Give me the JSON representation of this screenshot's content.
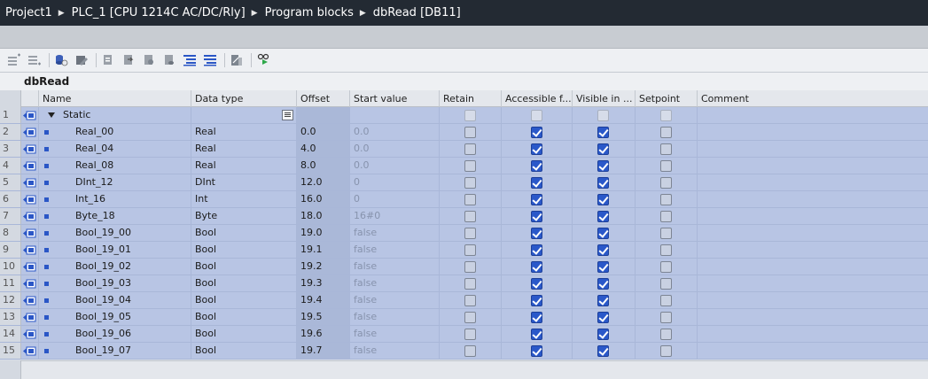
{
  "breadcrumb": [
    "Project1",
    "PLC_1 [CPU 1214C AC/DC/Rly]",
    "Program blocks",
    "dbRead [DB11]"
  ],
  "block_title": "dbRead",
  "toolbar_icons": [
    "insert-row-icon",
    "add-row-icon",
    "reset-start-values-icon",
    "snapshot-icon",
    "copy-snapshot-icon",
    "load-start-values-icon",
    "load-snapshot-icon",
    "monitor-icon",
    "expand-all-icon",
    "collapse-all-icon",
    "keep-actual-values-icon",
    "monitor-all-icon"
  ],
  "columns": {
    "name": "Name",
    "data_type": "Data type",
    "offset": "Offset",
    "start_value": "Start value",
    "retain": "Retain",
    "accessible": "Accessible f...",
    "visible": "Visible in ...",
    "setpoint": "Setpoint",
    "comment": "Comment"
  },
  "rows": [
    {
      "num": "1",
      "name": "Static",
      "type": "",
      "offset": "",
      "start": "",
      "retain": false,
      "accessible": false,
      "visible": false,
      "setpoint": false
    },
    {
      "num": "2",
      "name": "Real_00",
      "type": "Real",
      "offset": "0.0",
      "start": "0.0",
      "retain": false,
      "accessible": true,
      "visible": true,
      "setpoint": false
    },
    {
      "num": "3",
      "name": "Real_04",
      "type": "Real",
      "offset": "4.0",
      "start": "0.0",
      "retain": false,
      "accessible": true,
      "visible": true,
      "setpoint": false
    },
    {
      "num": "4",
      "name": "Real_08",
      "type": "Real",
      "offset": "8.0",
      "start": "0.0",
      "retain": false,
      "accessible": true,
      "visible": true,
      "setpoint": false
    },
    {
      "num": "5",
      "name": "DInt_12",
      "type": "DInt",
      "offset": "12.0",
      "start": "0",
      "retain": false,
      "accessible": true,
      "visible": true,
      "setpoint": false
    },
    {
      "num": "6",
      "name": "Int_16",
      "type": "Int",
      "offset": "16.0",
      "start": "0",
      "retain": false,
      "accessible": true,
      "visible": true,
      "setpoint": false
    },
    {
      "num": "7",
      "name": "Byte_18",
      "type": "Byte",
      "offset": "18.0",
      "start": "16#0",
      "retain": false,
      "accessible": true,
      "visible": true,
      "setpoint": false
    },
    {
      "num": "8",
      "name": "Bool_19_00",
      "type": "Bool",
      "offset": "19.0",
      "start": "false",
      "retain": false,
      "accessible": true,
      "visible": true,
      "setpoint": false
    },
    {
      "num": "9",
      "name": "Bool_19_01",
      "type": "Bool",
      "offset": "19.1",
      "start": "false",
      "retain": false,
      "accessible": true,
      "visible": true,
      "setpoint": false
    },
    {
      "num": "10",
      "name": "Bool_19_02",
      "type": "Bool",
      "offset": "19.2",
      "start": "false",
      "retain": false,
      "accessible": true,
      "visible": true,
      "setpoint": false
    },
    {
      "num": "11",
      "name": "Bool_19_03",
      "type": "Bool",
      "offset": "19.3",
      "start": "false",
      "retain": false,
      "accessible": true,
      "visible": true,
      "setpoint": false
    },
    {
      "num": "12",
      "name": "Bool_19_04",
      "type": "Bool",
      "offset": "19.4",
      "start": "false",
      "retain": false,
      "accessible": true,
      "visible": true,
      "setpoint": false
    },
    {
      "num": "13",
      "name": "Bool_19_05",
      "type": "Bool",
      "offset": "19.5",
      "start": "false",
      "retain": false,
      "accessible": true,
      "visible": true,
      "setpoint": false
    },
    {
      "num": "14",
      "name": "Bool_19_06",
      "type": "Bool",
      "offset": "19.6",
      "start": "false",
      "retain": false,
      "accessible": true,
      "visible": true,
      "setpoint": false
    },
    {
      "num": "15",
      "name": "Bool_19_07",
      "type": "Bool",
      "offset": "19.7",
      "start": "false",
      "retain": false,
      "accessible": true,
      "visible": true,
      "setpoint": false
    }
  ],
  "colors": {
    "row_selected": "#b8c5e4",
    "checkbox_checked": "#2a58c9",
    "titlebar": "#232a33",
    "member_bullet": "#2a56c6"
  }
}
